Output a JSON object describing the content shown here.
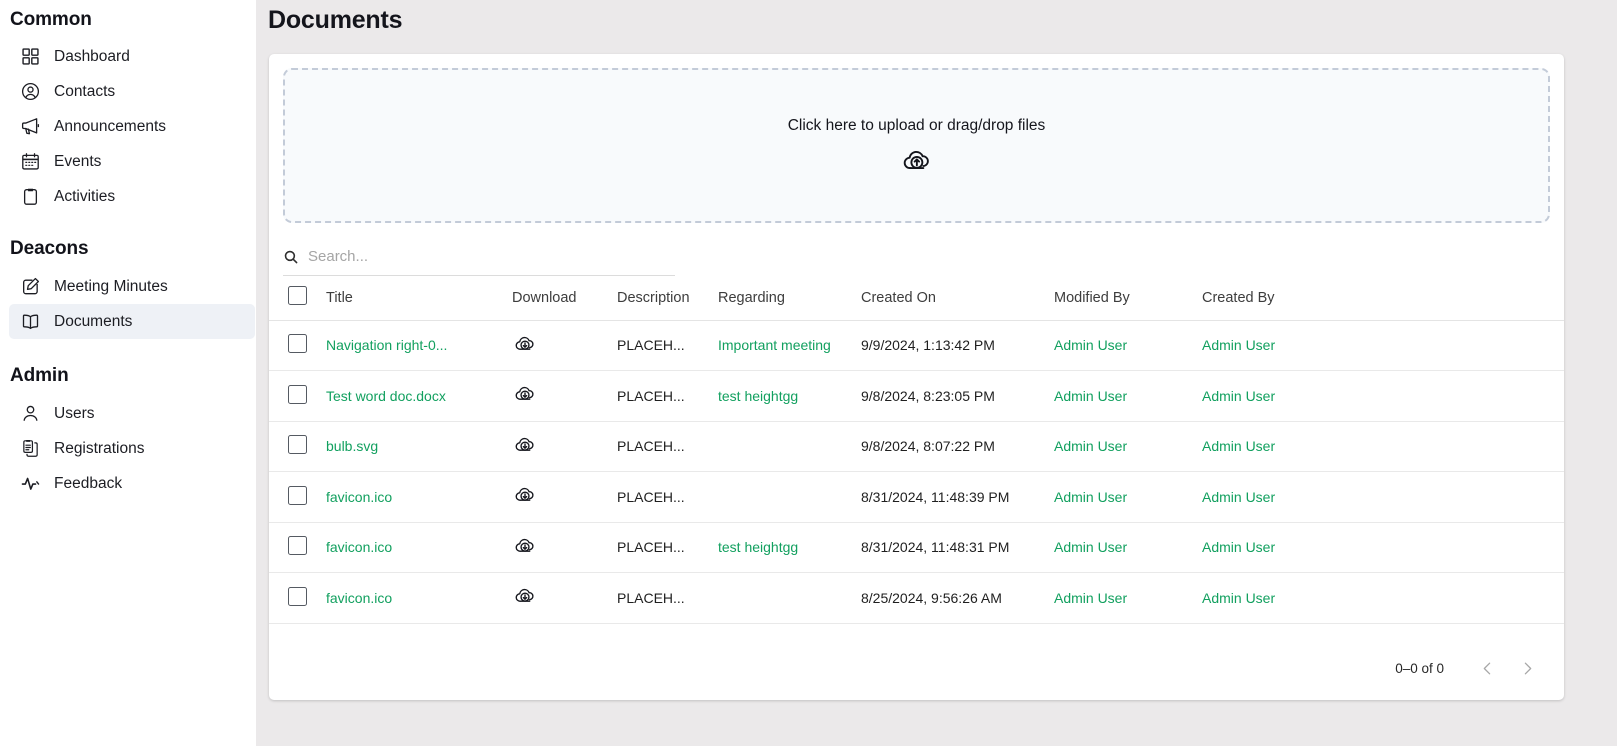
{
  "sidebar": {
    "sections": [
      {
        "heading": "Common",
        "items": [
          {
            "label": "Dashboard",
            "icon": "grid-icon",
            "active": false
          },
          {
            "label": "Contacts",
            "icon": "person-circle-icon",
            "active": false
          },
          {
            "label": "Announcements",
            "icon": "megaphone-icon",
            "active": false
          },
          {
            "label": "Events",
            "icon": "calendar-icon",
            "active": false
          },
          {
            "label": "Activities",
            "icon": "clipboard-icon",
            "active": false
          }
        ]
      },
      {
        "heading": "Deacons",
        "items": [
          {
            "label": "Meeting Minutes",
            "icon": "pencil-square-icon",
            "active": false
          },
          {
            "label": "Documents",
            "icon": "book-open-icon",
            "active": true
          }
        ]
      },
      {
        "heading": "Admin",
        "items": [
          {
            "label": "Users",
            "icon": "person-icon",
            "active": false
          },
          {
            "label": "Registrations",
            "icon": "clipboard-list-icon",
            "active": false
          },
          {
            "label": "Feedback",
            "icon": "pulse-icon",
            "active": false
          }
        ]
      }
    ]
  },
  "header": {
    "title": "Documents"
  },
  "dropzone": {
    "text": "Click here to upload or drag/drop files",
    "icon": "cloud-upload-icon"
  },
  "search": {
    "placeholder": "Search...",
    "value": "",
    "icon": "search-icon"
  },
  "table": {
    "columns": [
      "Title",
      "Download",
      "Description",
      "Regarding",
      "Created On",
      "Modified By",
      "Created By"
    ],
    "select_all_checked": false,
    "download_icon": "cloud-download-icon",
    "rows": [
      {
        "checked": false,
        "title": "Navigation right-0...",
        "description": "PLACEH...",
        "regarding": "Important meeting",
        "created_on": "9/9/2024, 1:13:42 PM",
        "modified_by": "Admin User",
        "created_by": "Admin User"
      },
      {
        "checked": false,
        "title": "Test word doc.docx",
        "description": "PLACEH...",
        "regarding": "test heightgg",
        "created_on": "9/8/2024, 8:23:05 PM",
        "modified_by": "Admin User",
        "created_by": "Admin User"
      },
      {
        "checked": false,
        "title": "bulb.svg",
        "description": "PLACEH...",
        "regarding": "",
        "created_on": "9/8/2024, 8:07:22 PM",
        "modified_by": "Admin User",
        "created_by": "Admin User"
      },
      {
        "checked": false,
        "title": "favicon.ico",
        "description": "PLACEH...",
        "regarding": "",
        "created_on": "8/31/2024, 11:48:39 PM",
        "modified_by": "Admin User",
        "created_by": "Admin User"
      },
      {
        "checked": false,
        "title": "favicon.ico",
        "description": "PLACEH...",
        "regarding": "test heightgg",
        "created_on": "8/31/2024, 11:48:31 PM",
        "modified_by": "Admin User",
        "created_by": "Admin User"
      },
      {
        "checked": false,
        "title": "favicon.ico",
        "description": "PLACEH...",
        "regarding": "",
        "created_on": "8/25/2024, 9:56:26 AM",
        "modified_by": "Admin User",
        "created_by": "Admin User"
      }
    ]
  },
  "pagination": {
    "range_label": "0–0 of 0",
    "prev_icon": "chevron-left-icon",
    "next_icon": "chevron-right-icon"
  },
  "colors": {
    "link_green": "#12a05f",
    "page_background": "#ebe9ea",
    "active_nav": "#eef1f6",
    "dropzone_border": "#c3cbd8"
  }
}
